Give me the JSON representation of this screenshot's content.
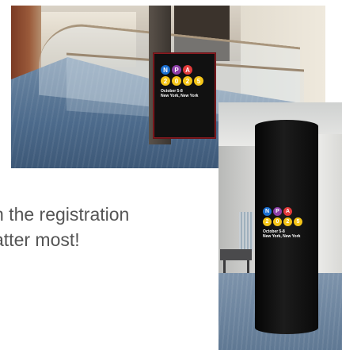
{
  "logo": {
    "row1": [
      {
        "letter": "N",
        "color": "#1a6fd1",
        "text_color": "#ffffff"
      },
      {
        "letter": "P",
        "color": "#8e3fa8",
        "text_color": "#ffffff"
      },
      {
        "letter": "A",
        "color": "#e23a3a",
        "text_color": "#ffffff"
      }
    ],
    "row2": [
      {
        "letter": "2",
        "color": "#f5c518",
        "text_color": "#ffffff"
      },
      {
        "letter": "0",
        "color": "#f5c518",
        "text_color": "#ffffff"
      },
      {
        "letter": "2",
        "color": "#f5c518",
        "text_color": "#ffffff"
      },
      {
        "letter": "5",
        "color": "#f5c518",
        "text_color": "#ffffff"
      }
    ],
    "dates": "October 5-8",
    "location": "New York, New York"
  },
  "body_text": {
    "line1": "n the registration",
    "line2": "atter most!"
  },
  "colors": {
    "text": "#555555",
    "banner_border": "#8a1b20"
  }
}
